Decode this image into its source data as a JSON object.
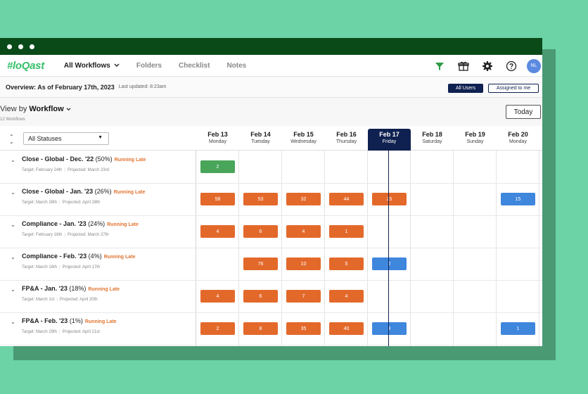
{
  "app": {
    "logo": "#loQast",
    "nav": {
      "workflows": "All Workflows",
      "folders": "Folders",
      "checklist": "Checklist",
      "notes": "Notes"
    },
    "avatar": "NL"
  },
  "overview": {
    "title": "Overview: As of February 17th, 2023",
    "updated": "Last updated: 8:23am",
    "all_users": "All Users",
    "assigned": "Assigned to me"
  },
  "view": {
    "prefix": "View by ",
    "mode": "Workflow",
    "count": "12 Workflows",
    "today_button": "Today"
  },
  "filters": {
    "status": "All Statuses"
  },
  "days": [
    {
      "date": "Feb 13",
      "weekday": "Monday"
    },
    {
      "date": "Feb 14",
      "weekday": "Tuesday"
    },
    {
      "date": "Feb 15",
      "weekday": "Wednesday"
    },
    {
      "date": "Feb 16",
      "weekday": "Thursday"
    },
    {
      "date": "Feb 17",
      "weekday": "Friday"
    },
    {
      "date": "Feb 18",
      "weekday": "Saturday"
    },
    {
      "date": "Feb 19",
      "weekday": "Sunday"
    },
    {
      "date": "Feb 20",
      "weekday": "Monday"
    }
  ],
  "colors": {
    "late": "#e3692b",
    "today": "#3f86dd",
    "done": "#48a55a",
    "brand": "#0f2150"
  },
  "workflows": [
    {
      "name": "Close - Global - Dec. '22",
      "pct": " (50%)",
      "status": "Running Late",
      "target": "Target: February 24th",
      "projected": "Projected: March 23rd",
      "cells": [
        {
          "value": "2",
          "color": "green"
        },
        null,
        null,
        null,
        null,
        null,
        null,
        null
      ]
    },
    {
      "name": "Close - Global - Jan. '23",
      "pct": " (26%)",
      "status": "Running Late",
      "target": "Target: March 28th",
      "projected": "Projected: April 28th",
      "cells": [
        {
          "value": "58",
          "color": "orange"
        },
        {
          "value": "53",
          "color": "orange"
        },
        {
          "value": "32",
          "color": "orange"
        },
        {
          "value": "44",
          "color": "orange"
        },
        {
          "value": "25",
          "color": "orange"
        },
        null,
        null,
        {
          "value": "15",
          "color": "blue"
        }
      ]
    },
    {
      "name": "Compliance - Jan. '23",
      "pct": " (24%)",
      "status": "Running Late",
      "target": "Target: February 16th",
      "projected": "Projected: March 27th",
      "cells": [
        {
          "value": "4",
          "color": "orange"
        },
        {
          "value": "6",
          "color": "orange"
        },
        {
          "value": "4",
          "color": "orange"
        },
        {
          "value": "1",
          "color": "orange"
        },
        null,
        null,
        null,
        null
      ]
    },
    {
      "name": "Compliance - Feb. '23",
      "pct": " (4%)",
      "status": "Running Late",
      "target": "Target: March 16th",
      "projected": "Projected: April 17th",
      "cells": [
        null,
        {
          "value": "76",
          "color": "orange"
        },
        {
          "value": "10",
          "color": "orange"
        },
        {
          "value": "5",
          "color": "orange"
        },
        {
          "value": "2",
          "color": "blue"
        },
        null,
        null,
        null
      ]
    },
    {
      "name": "FP&A - Jan. '23",
      "pct": " (18%)",
      "status": "Running Late",
      "target": "Target: March 1st",
      "projected": "Projected: April 20th",
      "cells": [
        {
          "value": "4",
          "color": "orange"
        },
        {
          "value": "6",
          "color": "orange"
        },
        {
          "value": "7",
          "color": "orange"
        },
        {
          "value": "4",
          "color": "orange"
        },
        null,
        null,
        null,
        null
      ]
    },
    {
      "name": "FP&A - Feb. '23",
      "pct": " (1%)",
      "status": "Running Late",
      "target": "Target: March 29th",
      "projected": "Projected: April 21st",
      "cells": [
        {
          "value": "2",
          "color": "orange"
        },
        {
          "value": "8",
          "color": "orange"
        },
        {
          "value": "35",
          "color": "orange"
        },
        {
          "value": "40",
          "color": "orange"
        },
        {
          "value": "3",
          "color": "blue"
        },
        null,
        null,
        {
          "value": "1",
          "color": "blue"
        }
      ]
    }
  ]
}
